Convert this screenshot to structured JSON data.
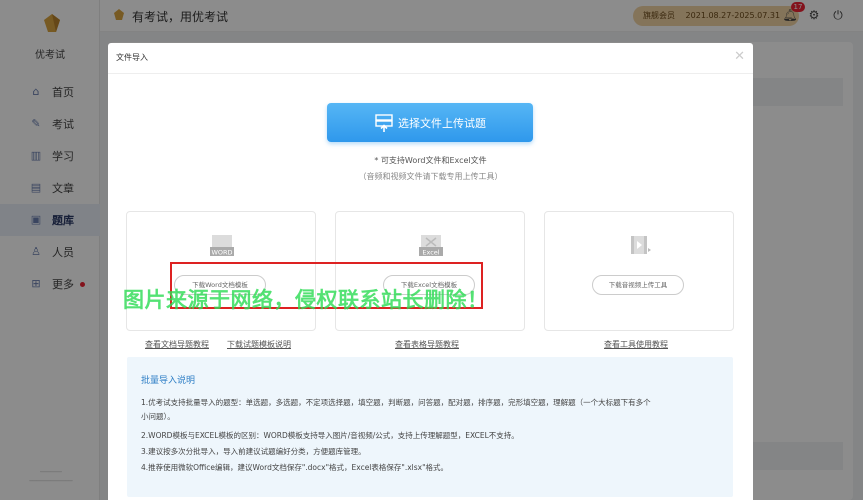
{
  "sidebar": {
    "logo_text": "优考试",
    "items": [
      {
        "label": "首页",
        "icon": "home-icon"
      },
      {
        "label": "考试",
        "icon": "exam-icon"
      },
      {
        "label": "学习",
        "icon": "book-icon"
      },
      {
        "label": "文章",
        "icon": "article-icon"
      },
      {
        "label": "题库",
        "icon": "question-bank-icon"
      },
      {
        "label": "人员",
        "icon": "user-icon"
      },
      {
        "label": "更多",
        "icon": "more-icon"
      }
    ],
    "active_index": 4
  },
  "topbar": {
    "slogan": "有考试，用优考试",
    "vip_label": "旗舰会员",
    "vip_period": "2021.08.27-2025.07.31",
    "notification_count": "17"
  },
  "dialog": {
    "title": "文件导入",
    "upload_button": "选择文件上传试题",
    "hint_main": "* 可支持Word文件和Excel文件",
    "hint_sub": "（音频和视频文件请下载专用上传工具）",
    "cards": [
      {
        "file_label": "WORD",
        "button": "下载Word文档模板"
      },
      {
        "file_label": "Excel",
        "button": "下载Excel文档模板"
      },
      {
        "file_label": "",
        "button": "下载音视频上传工具"
      }
    ],
    "links": [
      "查看文档导题教程",
      "下载试题模板说明",
      "查看表格导题教程",
      "查看工具使用教程"
    ],
    "info": {
      "title": "批量导入说明",
      "lines": [
        "1.优考试支持批量导入的题型：单选题，多选题，不定项选择题，填空题，判断题，问答题，配对题，排序题，完形填空题，理解题（一个大标题下有多个",
        "小问题）。",
        "2.WORD模板与EXCEL模板的区别：WORD模板支持导入图片/音视频/公式，支持上传理解题型，EXCEL不支持。",
        "3.建议按多次分批导入，导入前建议试题编好分类，方便题库管理。",
        "4.推荐使用微软Office编辑，建议Word文档保存\".docx\"格式，Excel表格保存\".xlsx\"格式。"
      ]
    }
  },
  "watermark": "图片来源于网络，侵权联系站长删除！",
  "colors": {
    "primary_blue": "#3ba6f2",
    "highlight_red": "#d22222",
    "watermark_green": "#2edc56",
    "vip_gold": "#f1d3a4"
  }
}
